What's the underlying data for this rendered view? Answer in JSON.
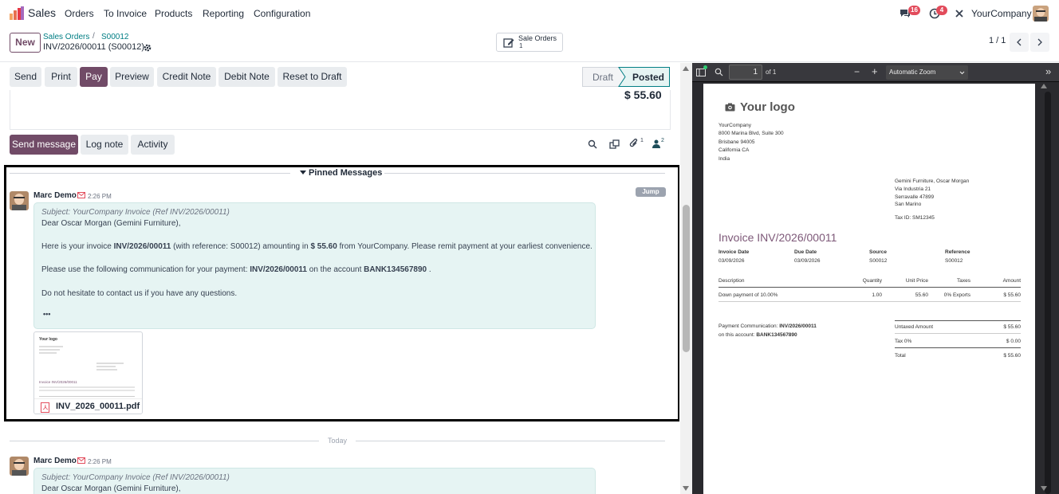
{
  "nav": {
    "app_name": "Sales",
    "menu": [
      "Orders",
      "To Invoice",
      "Products",
      "Reporting",
      "Configuration"
    ],
    "messages_count": "16",
    "activities_count": "4",
    "company": "YourCompany"
  },
  "control": {
    "new_label": "New",
    "breadcrumb_parent": "Sales Orders",
    "breadcrumb_sep": "/",
    "breadcrumb_child": "S00012",
    "record_title": "INV/2026/00011 (S00012)",
    "smart_button_label": "Sale Orders",
    "smart_button_count": "1",
    "pager": "1 / 1"
  },
  "actions": {
    "send": "Send",
    "print": "Print",
    "pay": "Pay",
    "preview": "Preview",
    "credit_note": "Credit Note",
    "debit_note": "Debit Note",
    "reset": "Reset to Draft",
    "status_draft": "Draft",
    "status_posted": "Posted"
  },
  "form": {
    "amount_due": "$ 55.60"
  },
  "chatter": {
    "send_message": "Send message",
    "log_note": "Log note",
    "activity": "Activity",
    "attachments_count": "1",
    "followers_count": "2",
    "pinned_title": "Pinned Messages",
    "jump": "Jump",
    "today": "Today"
  },
  "message": {
    "author": "Marc Demo",
    "time": "2:26 PM",
    "subject": "Subject: YourCompany Invoice (Ref INV/2026/00011)",
    "greeting": "Dear Oscar Morgan (Gemini Furniture),",
    "line1_a": "Here is your invoice ",
    "line1_inv": "INV/2026/00011",
    "line1_b": " (with reference: S00012) amounting in ",
    "line1_amt": "$ 55.60",
    "line1_c": " from YourCompany. Please remit payment at your earliest convenience.",
    "line2_a": "Please use the following communication for your payment: ",
    "line2_inv": "INV/2026/00011",
    "line2_b": " on the account ",
    "line2_acc": "BANK134567890",
    "line2_c": " .",
    "line3": "Do not hesitate to contact us if you have any questions.",
    "more": "•••",
    "attachment_name": "INV_2026_00011.pdf"
  },
  "message2": {
    "author": "Marc Demo",
    "time": "2:26 PM",
    "subject": "Subject: YourCompany Invoice (Ref INV/2026/00011)",
    "greeting": "Dear Oscar Morgan (Gemini Furniture),"
  },
  "pdf_toolbar": {
    "page": "1",
    "of_pages": "of 1",
    "zoom": "Automatic Zoom"
  },
  "pdf": {
    "logo_text": "Your logo",
    "company_lines": [
      "YourCompany",
      "8000 Marina Blvd, Suite 300",
      "Brisbane 94005",
      "California CA",
      "India"
    ],
    "customer_lines": [
      "Gemini Furniture, Oscar Morgan",
      "Via Industria 21",
      "Serravalle 47899",
      "San Marino"
    ],
    "tax_id": "Tax ID: SM12345",
    "title": "Invoice INV/2026/00011",
    "info_labels": [
      "Invoice Date",
      "Due Date",
      "Source",
      "Reference"
    ],
    "info_values": [
      "03/09/2026",
      "03/09/2026",
      "S00012",
      "S00012"
    ],
    "headers": [
      "Description",
      "Quantity",
      "Unit Price",
      "Taxes",
      "Amount"
    ],
    "line": [
      "Down payment of 10.00%",
      "1.00",
      "55.60",
      "0% Exports",
      "$ 55.60"
    ],
    "payment_comm_label": "Payment Communication: ",
    "payment_comm_value": "INV/2026/00011",
    "account_label": "on this account: ",
    "account_value": "BANK134567890",
    "untaxed_label": "Untaxed Amount",
    "untaxed_value": "$ 55.60",
    "tax_label": "Tax 0%",
    "tax_value": "$ 0.00",
    "total_label": "Total",
    "total_value": "$ 55.60"
  },
  "thumb": {
    "logo": "Your logo",
    "title": "Invoice INV/2026/00011"
  }
}
